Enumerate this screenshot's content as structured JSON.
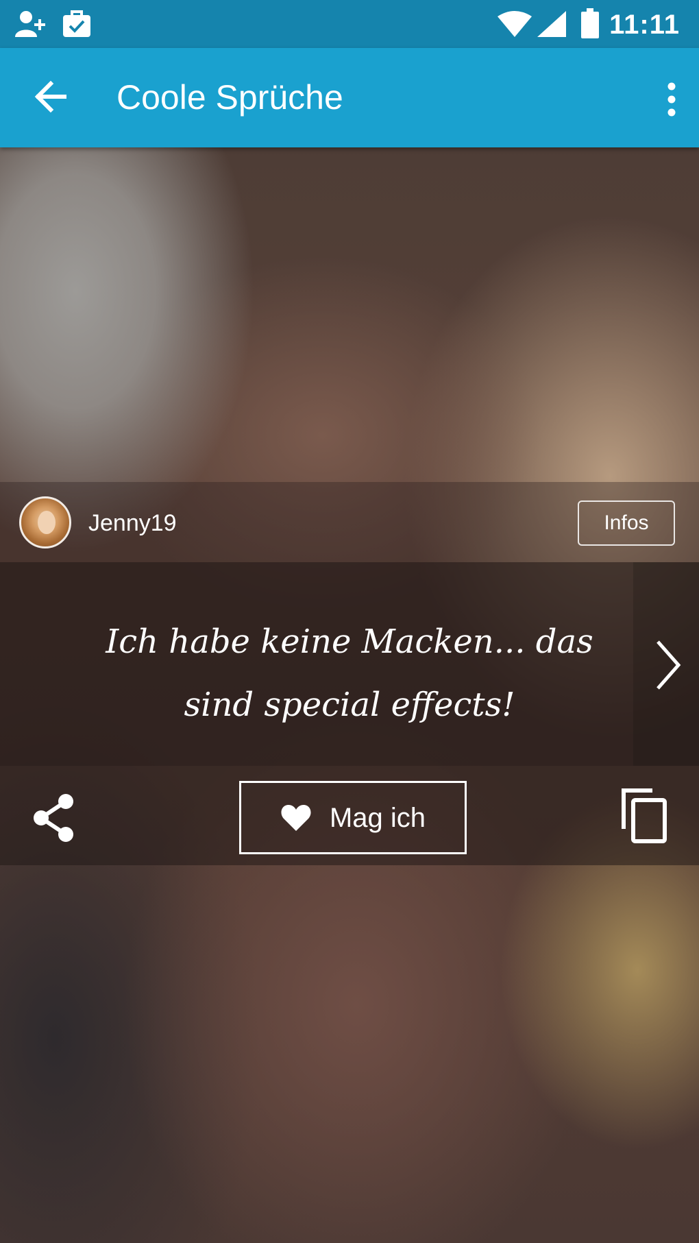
{
  "status_bar": {
    "time": "11:11",
    "icons": [
      "add-contact-icon",
      "briefcase-check-icon",
      "wifi-icon",
      "cell-signal-icon",
      "battery-icon"
    ]
  },
  "app_bar": {
    "title": "Coole Sprüche",
    "back_icon": "arrow-back-icon",
    "menu_icon": "more-vert-icon"
  },
  "post": {
    "username": "Jenny19",
    "infos_label": "Infos",
    "quote_lines": [
      "Ich habe keine Macken... das",
      "sind special effects!"
    ],
    "next_icon": "chevron-right-icon"
  },
  "actions": {
    "share_icon": "share-icon",
    "like_label": "Mag ich",
    "like_icon": "heart-icon",
    "copy_icon": "copy-icon"
  },
  "colors": {
    "status_bar": "#1584ad",
    "app_bar": "#1aa1cf",
    "text": "#ffffff"
  }
}
